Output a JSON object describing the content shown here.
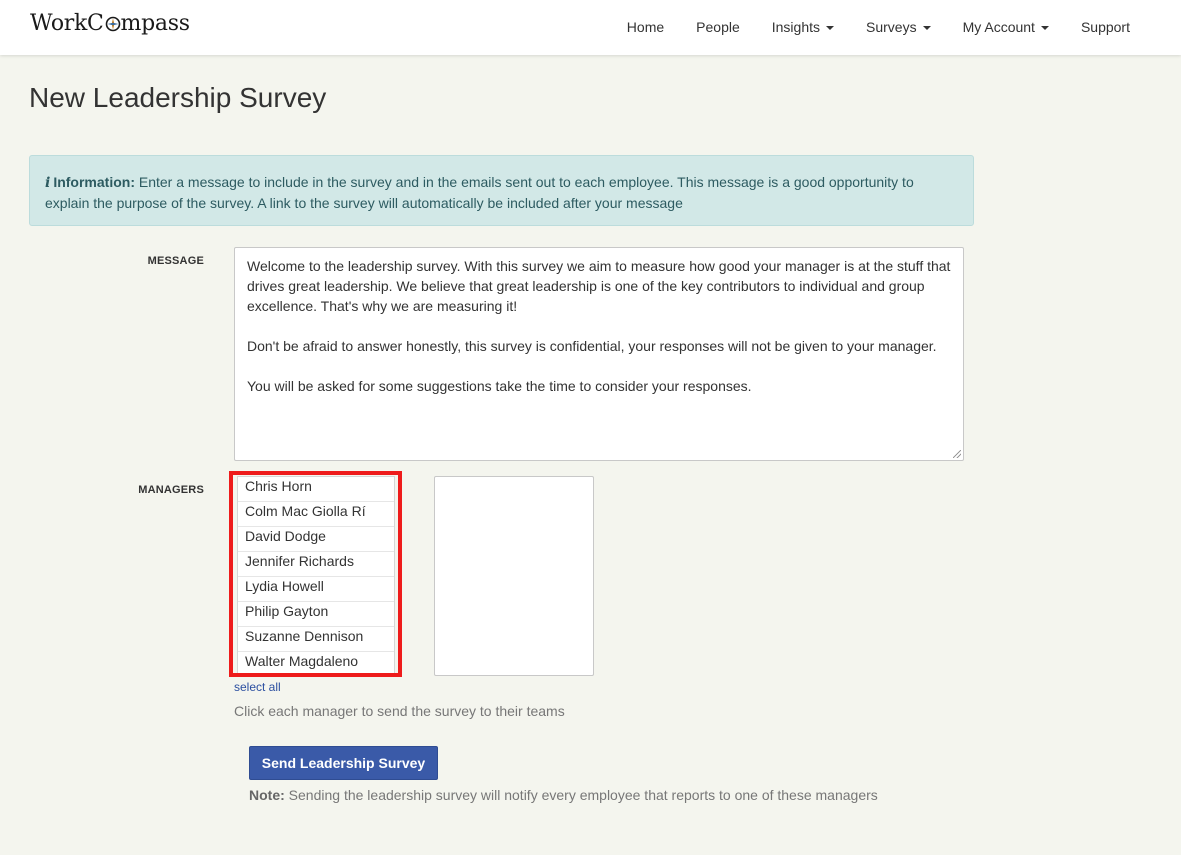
{
  "brand": {
    "name_part1": "WorkC",
    "name_part2": "mpass",
    "accent": "#3a5aa8"
  },
  "nav": {
    "items": [
      {
        "label": "Home",
        "dropdown": false
      },
      {
        "label": "People",
        "dropdown": false
      },
      {
        "label": "Insights",
        "dropdown": true
      },
      {
        "label": "Surveys",
        "dropdown": true
      },
      {
        "label": "My Account",
        "dropdown": true
      },
      {
        "label": "Support",
        "dropdown": false
      }
    ]
  },
  "page": {
    "title": "New Leadership Survey"
  },
  "info": {
    "icon": "info-icon",
    "heading": "Information:",
    "text": " Enter a message to include in the survey and in the emails sent out to each employee. This message is a good opportunity to explain the purpose of the survey. A link to the survey will automatically be included after your message"
  },
  "form": {
    "message_label": "MESSAGE",
    "message_value": "Welcome to the leadership survey. With this survey we aim to measure how good your manager is at the stuff that drives great leadership. We believe that great leadership is one of the key contributors to individual and group excellence. That's why we are measuring it!\n\nDon't be afraid to answer honestly, this survey is confidential, your responses will not be given to your manager.\n\nYou will be asked for some suggestions take the time to consider your responses.",
    "managers_label": "MANAGERS",
    "managers": [
      "Chris Horn",
      "Colm Mac Giolla Rí",
      "David Dodge",
      "Jennifer Richards",
      "Lydia Howell",
      "Philip Gayton",
      "Suzanne Dennison",
      "Walter Magdaleno"
    ],
    "select_all": "select all",
    "help": "Click each manager to send the survey to their teams",
    "submit_label": "Send Leadership Survey",
    "note_heading": "Note:",
    "note_text": " Sending the leadership survey will notify every employee that reports to one of these managers"
  },
  "colors": {
    "highlight": "#ee1b1b",
    "alert_bg": "#d2e8e7",
    "page_bg": "#f4f5ee"
  }
}
